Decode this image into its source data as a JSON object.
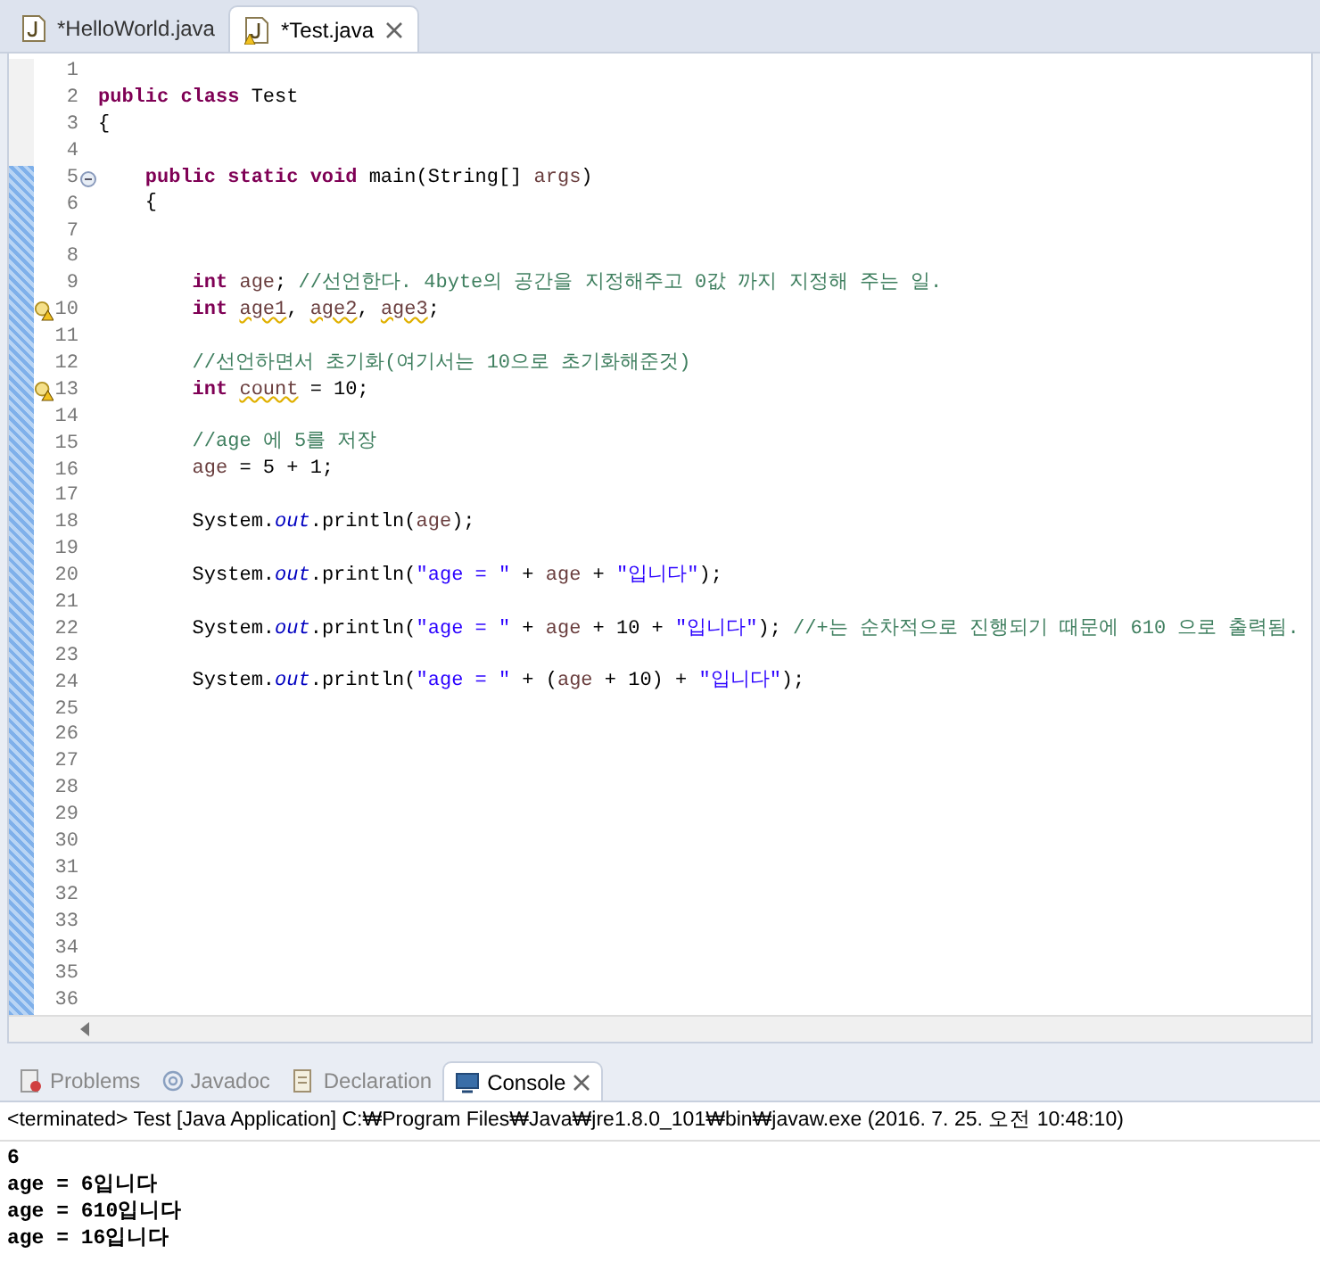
{
  "editor_tabs": [
    {
      "label": "*HelloWorld.java",
      "selected": false,
      "warning": false
    },
    {
      "label": "*Test.java",
      "selected": true,
      "warning": true
    }
  ],
  "editor": {
    "lines": [
      {
        "number": "1"
      },
      {
        "number": "2",
        "tokens": [
          {
            "kind": "keyword",
            "text": "public class"
          },
          {
            "kind": "plain",
            "text": " Test"
          }
        ]
      },
      {
        "number": "3",
        "tokens": [
          {
            "kind": "plain",
            "text": "{"
          }
        ]
      },
      {
        "number": "4"
      },
      {
        "number": "5",
        "fold": true,
        "tokens": [
          {
            "kind": "keyword",
            "text": "    public static void"
          },
          {
            "kind": "plain",
            "text": " main(String[] "
          },
          {
            "kind": "local",
            "text": "args"
          },
          {
            "kind": "plain",
            "text": ")"
          }
        ]
      },
      {
        "number": "6",
        "tokens": [
          {
            "kind": "plain",
            "text": "    {"
          }
        ]
      },
      {
        "number": "7"
      },
      {
        "number": "8"
      },
      {
        "number": "9",
        "tokens": [
          {
            "kind": "keyword",
            "text": "        int"
          },
          {
            "kind": "local",
            "text": " age"
          },
          {
            "kind": "plain",
            "text": "; "
          },
          {
            "kind": "comment",
            "text": "//선언한다. 4byte의 공간을 지정해주고 0값 까지 지정해 주는 일."
          }
        ]
      },
      {
        "number": "10",
        "warning": true,
        "tokens": [
          {
            "kind": "keyword",
            "text": "        int "
          },
          {
            "kind": "warned",
            "text": "age1"
          },
          {
            "kind": "plain",
            "text": ", "
          },
          {
            "kind": "warned",
            "text": "age2"
          },
          {
            "kind": "plain",
            "text": ", "
          },
          {
            "kind": "warned",
            "text": "age3"
          },
          {
            "kind": "plain",
            "text": ";"
          }
        ]
      },
      {
        "number": "11"
      },
      {
        "number": "12",
        "tokens": [
          {
            "kind": "comment",
            "text": "        //선언하면서 초기화(여기서는 10으로 초기화해준것)"
          }
        ]
      },
      {
        "number": "13",
        "warning": true,
        "tokens": [
          {
            "kind": "keyword",
            "text": "        int "
          },
          {
            "kind": "warned",
            "text": "count"
          },
          {
            "kind": "plain",
            "text": " = 10;"
          }
        ]
      },
      {
        "number": "14"
      },
      {
        "number": "15",
        "tokens": [
          {
            "kind": "comment",
            "text": "        //age 에 5를 저장"
          }
        ]
      },
      {
        "number": "16",
        "tokens": [
          {
            "kind": "local",
            "text": "        age"
          },
          {
            "kind": "plain",
            "text": " = 5 + 1;"
          }
        ]
      },
      {
        "number": "17"
      },
      {
        "number": "18",
        "tokens": [
          {
            "kind": "plain",
            "text": "        System."
          },
          {
            "kind": "field",
            "text": "out"
          },
          {
            "kind": "plain",
            "text": ".println("
          },
          {
            "kind": "local",
            "text": "age"
          },
          {
            "kind": "plain",
            "text": ");"
          }
        ]
      },
      {
        "number": "19"
      },
      {
        "number": "20",
        "tokens": [
          {
            "kind": "plain",
            "text": "        System."
          },
          {
            "kind": "field",
            "text": "out"
          },
          {
            "kind": "plain",
            "text": ".println("
          },
          {
            "kind": "string",
            "text": "\"age = \""
          },
          {
            "kind": "plain",
            "text": " + "
          },
          {
            "kind": "local",
            "text": "age"
          },
          {
            "kind": "plain",
            "text": " + "
          },
          {
            "kind": "string",
            "text": "\"입니다\""
          },
          {
            "kind": "plain",
            "text": ");"
          }
        ]
      },
      {
        "number": "21"
      },
      {
        "number": "22",
        "tokens": [
          {
            "kind": "plain",
            "text": "        System."
          },
          {
            "kind": "field",
            "text": "out"
          },
          {
            "kind": "plain",
            "text": ".println("
          },
          {
            "kind": "string",
            "text": "\"age = \""
          },
          {
            "kind": "plain",
            "text": " + "
          },
          {
            "kind": "local",
            "text": "age"
          },
          {
            "kind": "plain",
            "text": " + 10 + "
          },
          {
            "kind": "string",
            "text": "\"입니다\""
          },
          {
            "kind": "plain",
            "text": "); "
          },
          {
            "kind": "comment",
            "text": "//+는 순차적으로 진행되기 때문에 610 으로 출력됨."
          }
        ]
      },
      {
        "number": "23"
      },
      {
        "number": "24",
        "tokens": [
          {
            "kind": "plain",
            "text": "        System."
          },
          {
            "kind": "field",
            "text": "out"
          },
          {
            "kind": "plain",
            "text": ".println("
          },
          {
            "kind": "string",
            "text": "\"age = \""
          },
          {
            "kind": "plain",
            "text": " + ("
          },
          {
            "kind": "local",
            "text": "age"
          },
          {
            "kind": "plain",
            "text": " + 10) + "
          },
          {
            "kind": "string",
            "text": "\"입니다\""
          },
          {
            "kind": "plain",
            "text": ");"
          }
        ]
      },
      {
        "number": "25"
      },
      {
        "number": "26"
      },
      {
        "number": "27"
      },
      {
        "number": "28"
      },
      {
        "number": "29"
      },
      {
        "number": "30"
      },
      {
        "number": "31"
      },
      {
        "number": "32"
      },
      {
        "number": "33"
      },
      {
        "number": "34"
      },
      {
        "number": "35"
      },
      {
        "number": "36"
      }
    ]
  },
  "panel_tabs": [
    {
      "kind": "problems",
      "label": "Problems",
      "selected": false
    },
    {
      "kind": "javadoc",
      "label": "Javadoc",
      "selected": false
    },
    {
      "kind": "declaration",
      "label": "Declaration",
      "selected": false
    },
    {
      "kind": "console",
      "label": "Console",
      "selected": true
    }
  ],
  "console": {
    "header": "<terminated> Test [Java Application] C:₩Program Files₩Java₩jre1.8.0_101₩bin₩javaw.exe (2016. 7. 25. 오전 10:48:10)",
    "output": [
      "6",
      "age = 6입니다",
      "age = 610입니다",
      "age = 16입니다"
    ]
  }
}
